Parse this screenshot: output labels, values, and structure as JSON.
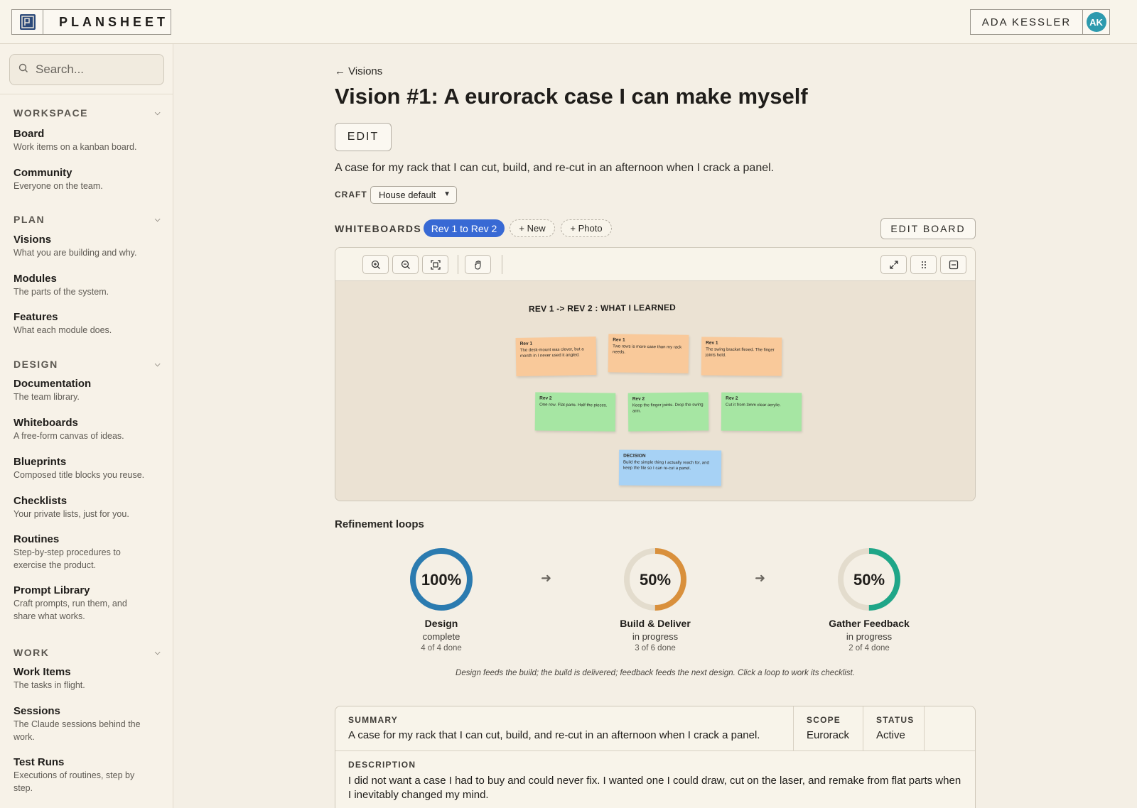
{
  "app": {
    "name": "PLANSHEET"
  },
  "user": {
    "name": "ADA KESSLER",
    "initials": "AK"
  },
  "search": {
    "placeholder": "Search..."
  },
  "sidebar": {
    "sections": [
      {
        "label": "WORKSPACE",
        "items": [
          {
            "title": "Board",
            "desc": "Work items on a kanban board."
          },
          {
            "title": "Community",
            "desc": "Everyone on the team."
          }
        ]
      },
      {
        "label": "PLAN",
        "items": [
          {
            "title": "Visions",
            "desc": "What you are building and why."
          },
          {
            "title": "Modules",
            "desc": "The parts of the system."
          },
          {
            "title": "Features",
            "desc": "What each module does."
          }
        ]
      },
      {
        "label": "DESIGN",
        "items": [
          {
            "title": "Documentation",
            "desc": "The team library."
          },
          {
            "title": "Whiteboards",
            "desc": "A free-form canvas of ideas."
          },
          {
            "title": "Blueprints",
            "desc": "Composed title blocks you reuse."
          },
          {
            "title": "Checklists",
            "desc": "Your private lists, just for you."
          },
          {
            "title": "Routines",
            "desc": "Step-by-step procedures to exercise the product."
          },
          {
            "title": "Prompt Library",
            "desc": "Craft prompts, run them, and share what works."
          }
        ]
      },
      {
        "label": "WORK",
        "items": [
          {
            "title": "Work Items",
            "desc": "The tasks in flight."
          },
          {
            "title": "Sessions",
            "desc": "The Claude sessions behind the work."
          },
          {
            "title": "Test Runs",
            "desc": "Executions of routines, step by step."
          }
        ]
      }
    ]
  },
  "main": {
    "back_label": "← Visions",
    "title": "Vision #1: A eurorack case I can make myself",
    "edit_label": "EDIT",
    "summary": "A case for my rack that I can cut, build, and re-cut in an afternoon when I crack a panel.",
    "craft": {
      "label": "CRAFT",
      "value": "House default"
    }
  },
  "whiteboards": {
    "label": "WHITEBOARDS",
    "active_tab": "Rev 1 to Rev 2",
    "new_label": "+ New",
    "photo_label": "+ Photo",
    "edit_board_label": "EDIT BOARD",
    "board": {
      "heading": "REV 1  ->  REV 2 : WHAT I LEARNED",
      "stickies": [
        {
          "tag": "Rev 1",
          "text": "The desk-mount was clever, but a month in I never used it angled.",
          "color": "#f9c99a"
        },
        {
          "tag": "Rev 1",
          "text": "Two rows is more case than my rack needs.",
          "color": "#f9c99a"
        },
        {
          "tag": "Rev 1",
          "text": "The swing bracket flexed. The finger joints held.",
          "color": "#f9c99a"
        },
        {
          "tag": "Rev 2",
          "text": "One row. Flat parts. Half the pieces.",
          "color": "#a6e6a3"
        },
        {
          "tag": "Rev 2",
          "text": "Keep the finger joints. Drop the swing arm.",
          "color": "#a6e6a3"
        },
        {
          "tag": "Rev 2",
          "text": "Cut it from 3mm clear acrylic.",
          "color": "#a6e6a3"
        },
        {
          "tag": "DECISION",
          "text": "Build the simple thing I actually reach for, and keep the file so I can re-cut a panel.",
          "color": "#a7d2f5"
        }
      ]
    }
  },
  "loops": {
    "title": "Refinement loops",
    "items": [
      {
        "percent_label": "100%",
        "progress": 1.0,
        "name": "Design",
        "state": "complete",
        "count": "4 of 4 done",
        "color": "#2b7bb0"
      },
      {
        "percent_label": "50%",
        "progress": 0.5,
        "name": "Build & Deliver",
        "state": "in progress",
        "count": "3 of 6 done",
        "color": "#d9903c"
      },
      {
        "percent_label": "50%",
        "progress": 0.5,
        "name": "Gather Feedback",
        "state": "in progress",
        "count": "2 of 4 done",
        "color": "#1fa688"
      }
    ],
    "caption": "Design feeds the build; the build is delivered; feedback feeds the next design. Click a loop to work its checklist."
  },
  "details": {
    "summary_label": "SUMMARY",
    "summary_value": "A case for my rack that I can cut, build, and re-cut in an afternoon when I crack a panel.",
    "scope_label": "SCOPE",
    "scope_value": "Eurorack",
    "status_label": "STATUS",
    "status_value": "Active",
    "description_label": "DESCRIPTION",
    "description_value": "I did not want a case I had to buy and could never fix. I wanted one I could draw, cut on the laser, and remake from flat parts when I inevitably changed my mind."
  },
  "colors": {
    "accent": "#3869d4",
    "background": "#f4efe5",
    "sidebar": "#f7f2e8"
  }
}
